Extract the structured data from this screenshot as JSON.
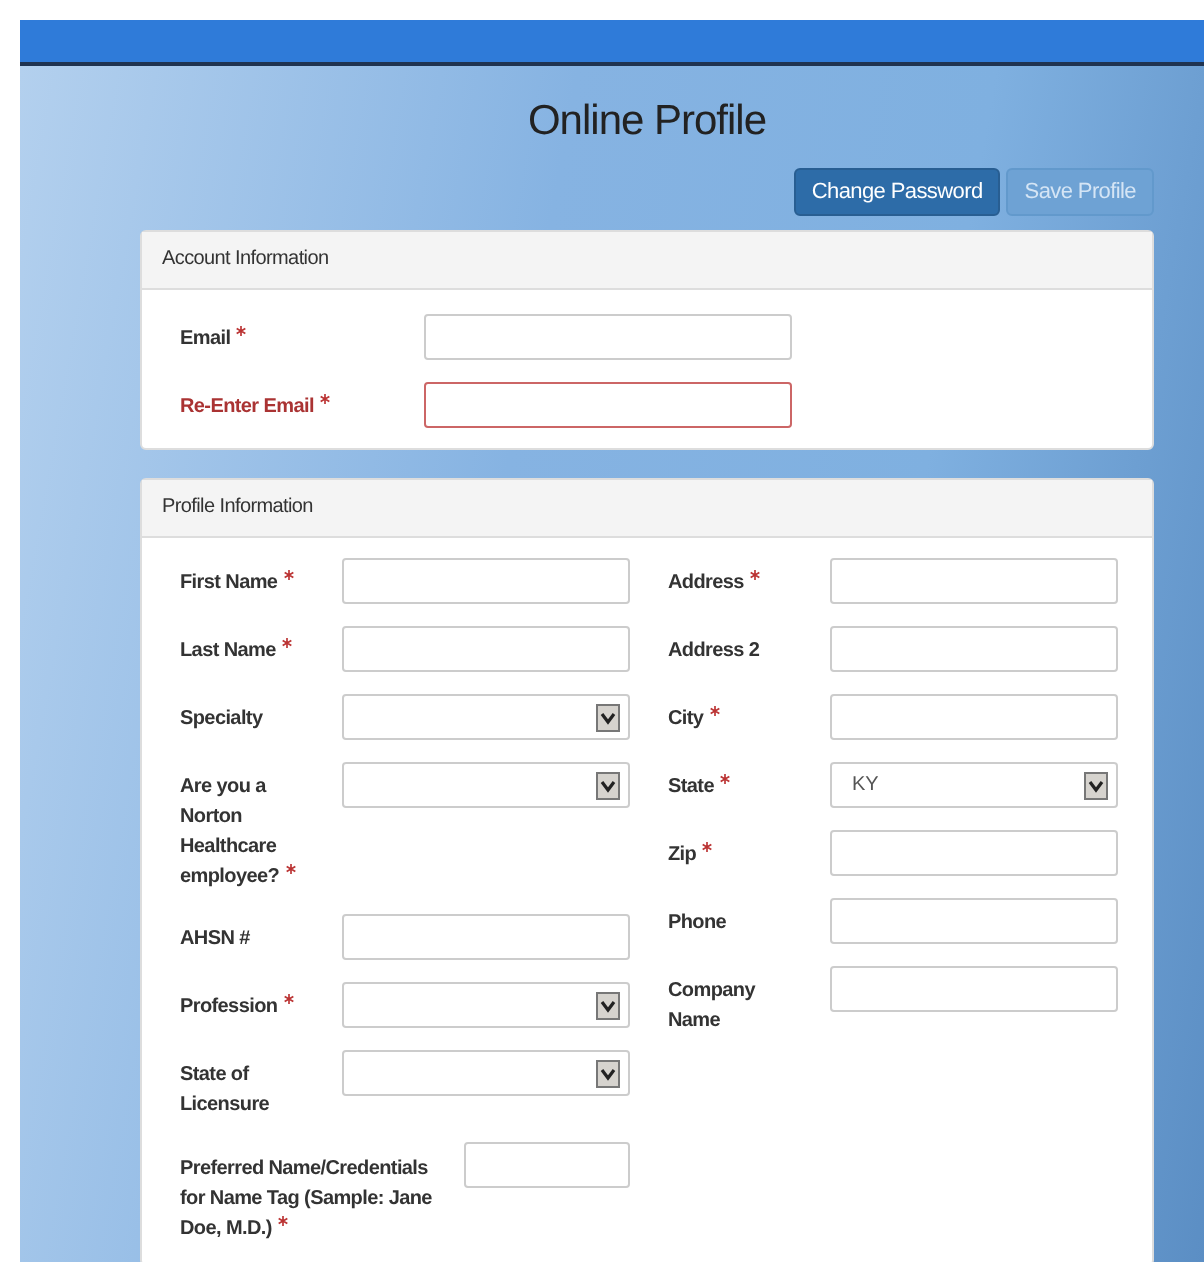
{
  "title": "Online Profile",
  "buttons": [
    {
      "label": "Change Password",
      "disabled": false
    },
    {
      "label": "Save Profile",
      "disabled": true
    }
  ],
  "account": {
    "heading": "Account Information",
    "fields": [
      {
        "label": "Email",
        "required": true,
        "error": false
      },
      {
        "label": "Re-Enter Email",
        "required": true,
        "error": true
      }
    ]
  },
  "profile": {
    "heading": "Profile Information",
    "left": [
      {
        "label": "First Name",
        "required": true,
        "kind": "text"
      },
      {
        "label": "Last Name",
        "required": true,
        "kind": "text"
      },
      {
        "label": "Specialty",
        "required": false,
        "kind": "select"
      },
      {
        "label": "Are you a Norton Healthcare employee?",
        "required": true,
        "kind": "select"
      },
      {
        "label": "AHSN #",
        "required": false,
        "kind": "text"
      },
      {
        "label": "Profession",
        "required": true,
        "kind": "select"
      },
      {
        "label": "State of Licensure",
        "required": false,
        "kind": "select"
      },
      {
        "label": "Preferred Name/Credentials for Name Tag (Sample: Jane Doe, M.D.)",
        "required": true,
        "kind": "short-text"
      }
    ],
    "right": [
      {
        "label": "Address",
        "required": true,
        "kind": "text"
      },
      {
        "label": "Address 2",
        "required": false,
        "kind": "text"
      },
      {
        "label": "City",
        "required": true,
        "kind": "text"
      },
      {
        "label": "State",
        "required": true,
        "kind": "select",
        "value": "KY"
      },
      {
        "label": "Zip",
        "required": true,
        "kind": "text"
      },
      {
        "label": "Phone",
        "required": false,
        "kind": "text"
      },
      {
        "label": "Company Name",
        "required": false,
        "kind": "text"
      }
    ]
  }
}
